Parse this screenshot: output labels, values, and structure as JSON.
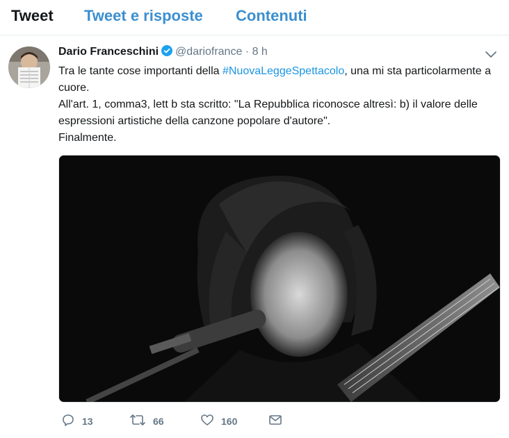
{
  "tabs": [
    {
      "label": "Tweet"
    },
    {
      "label": "Tweet e risposte"
    },
    {
      "label": "Contenuti"
    }
  ],
  "tweet": {
    "author_name": "Dario Franceschini",
    "handle": "@dariofrance",
    "separator": "·",
    "time": "8 h",
    "text_line1_pre": "Tra le tante cose importanti della ",
    "hashtag": "#NuovaLeggeSpettacolo",
    "text_line1_post": ", una mi sta particolarmente a cuore.",
    "text_line2": "All'art. 1, comma3, lett b sta scritto: \"La Repubblica riconosce altresì: b) il valore delle espressioni artistiche della canzone popolare d'autore\".",
    "text_line3": "Finalmente.",
    "icons": {
      "verified": "verified-badge-icon",
      "caret": "chevron-down-icon",
      "reply": "reply-icon",
      "retweet": "retweet-icon",
      "like": "heart-icon",
      "dm": "envelope-icon"
    },
    "actions": {
      "replies": "13",
      "retweets": "66",
      "likes": "160"
    }
  },
  "colors": {
    "accent": "#1da1f2",
    "link": "#1b95e0",
    "muted": "#657786",
    "text": "#14171a"
  }
}
